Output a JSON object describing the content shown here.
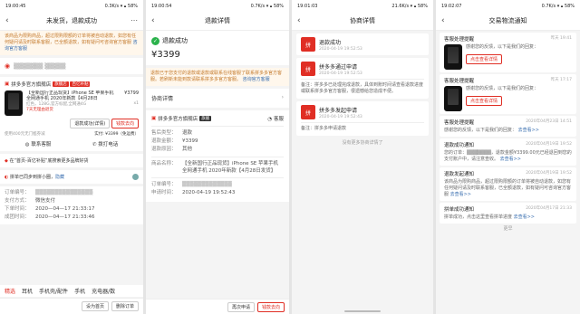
{
  "p1": {
    "status_time": "19:00:45",
    "status_right": "0.3K/s ▾ ▴ 58%",
    "nav_title": "未发货，退款成功",
    "notice": "该商品为限购商品，超过限购限额的订单将被自动退款，如您有任何疑问请及时联系客服，已全额退款，如有疑问可咨询官方客服",
    "notice_link": "咨询官方客服",
    "address_masked": "▒▒▒▒▒▒▒ ▒▒▒▒▒",
    "shop_name": "拼多多官方旗舰店",
    "shop_tag": "旗舰店",
    "shop_tag2": "百亿补贴",
    "product_title": "【全新国行正品现货】iPhone SE 苹果手机 全网通手机 2020年新款【4月28日",
    "product_price": "¥3799",
    "product_qty": "x1",
    "product_spec": "红色，128G,官方标配,全网通4G",
    "product_badge": "7天无理由退货",
    "btn_refund": "退款成功(详情)",
    "btn_refund_detail": "钱款去向",
    "discount_text": "使用400元无门槛券减",
    "paid_text": "实付: ¥3399（免运费）",
    "contact": "联系客服",
    "call": "拨打电话",
    "promo": "在“首页-百亿补贴”底搜索更多品牌好货",
    "friends": "拼单已同步到拼小圈，",
    "friends_link": "隐藏",
    "order_no_label": "订单编号：",
    "order_no": "▒▒▒▒▒▒▒▒▒▒▒▒▒▒▒",
    "pay_label": "支付方式：",
    "pay_value": "微信支付",
    "order_time_label": "下单时间：",
    "order_time": "2020—04—17 21:33:17",
    "group_time_label": "成团时间：",
    "group_time": "2020—04—17 21:33:46",
    "cats": [
      "精选",
      "耳机",
      "手机壳/配件",
      "手机",
      "充电器/数"
    ],
    "btn_home": "设为首页",
    "btn_delete": "删除订单"
  },
  "p2": {
    "status_time": "19:00:54",
    "status_right": "0.7K/s ▾ ▴ 58%",
    "nav_title": "退款详情",
    "status": "退款成功",
    "amount": "¥3399",
    "notice": "退款已于您支付的退款或退款或联系在线客服了联系拼多多官方客服。若刷新未能到款请联系拼多多官方客服。",
    "notice_link": "咨询官方客服",
    "negotiation": "协商详情",
    "shop_name": "拼多多官方旗舰店",
    "shop_badge": "旗舰",
    "service": "客服",
    "rows": [
      {
        "k": "售后类型：",
        "v": "退款"
      },
      {
        "k": "退款金额：",
        "v": "¥3399"
      },
      {
        "k": "退款原因：",
        "v": "其他"
      }
    ],
    "goods_label": "商品名称：",
    "goods_value": "【全新国行正品现货】iPhone SE 苹果手机 全网通手机 2020年新款【4月28日发货】",
    "order_label": "订单编号：",
    "order_value": "▒▒▒▒▒▒▒▒▒▒▒▒▒",
    "apply_label": "申请时间：",
    "apply_value": "2020-04-19 19:52:43",
    "btn_reapply": "再次申请",
    "btn_money": "钱款去向"
  },
  "p3": {
    "status_time": "19:01:03",
    "status_right": "21.6K/s ▾ ▴ 58%",
    "nav_title": "协商详情",
    "items": [
      {
        "title": "退款成功",
        "time": "2020-04-19 19:52:53",
        "note": ""
      },
      {
        "title": "拼多多通过申请",
        "time": "2020-04-19 19:52:53",
        "note": "备注：拼多多已处理完成退款，具体到账时间请查看退款进度或联系拼多多官方客服，很遗憾给您造成不便。"
      },
      {
        "title": "拼多多发起申请",
        "time": "2020-04-19 19:52:43",
        "note": "备注：拼多多申请退款"
      }
    ],
    "end_text": "没有更多协商详情了"
  },
  "p4": {
    "status_time": "19:02:07",
    "status_right": "0.7K/s ▾ ▴ 58%",
    "nav_title": "交易物流通知",
    "n1_title": "客服处理提醒",
    "n1_time": "昨天 19:41",
    "n1_desc": "感谢您的反馈，以下是我们的回复：",
    "n1_btn": "点击查看详情",
    "n2_title": "客服处理提醒",
    "n2_time": "昨天 17:17",
    "n2_desc": "感谢您的反馈，以下是我们的回复：",
    "n2_btn": "点击查看详情",
    "n3_title": "客服处理提醒",
    "n3_time": "2020年04月23日 14:51",
    "n3_desc": "感谢您的反馈，以下是我们的回复：",
    "n3_link": "去查看>>",
    "n4_title": "退款成功通知",
    "n4_time": "2020年04月19日 19:52",
    "n4_desc": "您的订单：▒▒▒▒▒▒▒，退款金额¥3399.00元已经退回到您的支付账户中，请注意查收。",
    "n4_link": "去查看>>",
    "n5_title": "退款发起通知",
    "n5_time": "2020年04月19日 19:52",
    "n5_desc": "该商品为限购商品，超过限购限额的订单将被自动退款，如您有任何疑问请及时联系客服，已全额退款，如有疑问可咨询官方客服",
    "n5_link": "去查看>>",
    "n6_title": "拼单成功通知",
    "n6_time": "2020年04月17日 21:33",
    "n6_desc": "拼单成功，点击这里查看拼单进度",
    "n6_link": "去查看>>",
    "end": "更早"
  }
}
